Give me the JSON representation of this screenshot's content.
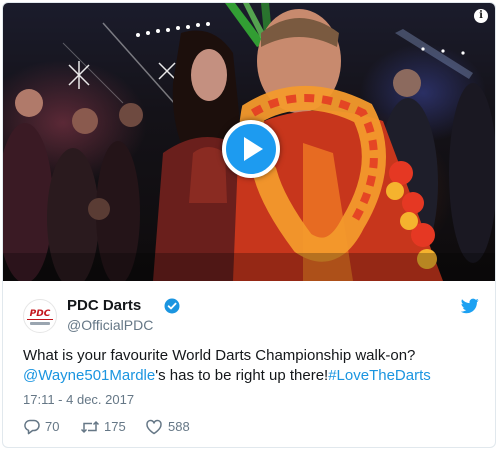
{
  "video": {
    "info_glyph": "i",
    "play_icon": "play-icon"
  },
  "tweet": {
    "author": {
      "display_name": "PDC Darts",
      "handle": "@OfficialPDC",
      "avatar_text": "PDC",
      "verified_icon": "verified-badge-icon"
    },
    "text_plain_1": "What is your favourite World Darts Championship walk-on? ",
    "mention": "@Wayne501Mardle",
    "text_plain_2": "'s has to be right up there!",
    "hashtag": "#LoveTheDarts",
    "timestamp": "17:11 - 4 dec. 2017",
    "actions": {
      "replies": "70",
      "retweets": "175",
      "likes": "588"
    }
  },
  "colors": {
    "accent": "#1b95e0",
    "play_button": "#1d9bf0",
    "text": "#14171a",
    "muted": "#657786",
    "brand_red": "#c3141b"
  }
}
